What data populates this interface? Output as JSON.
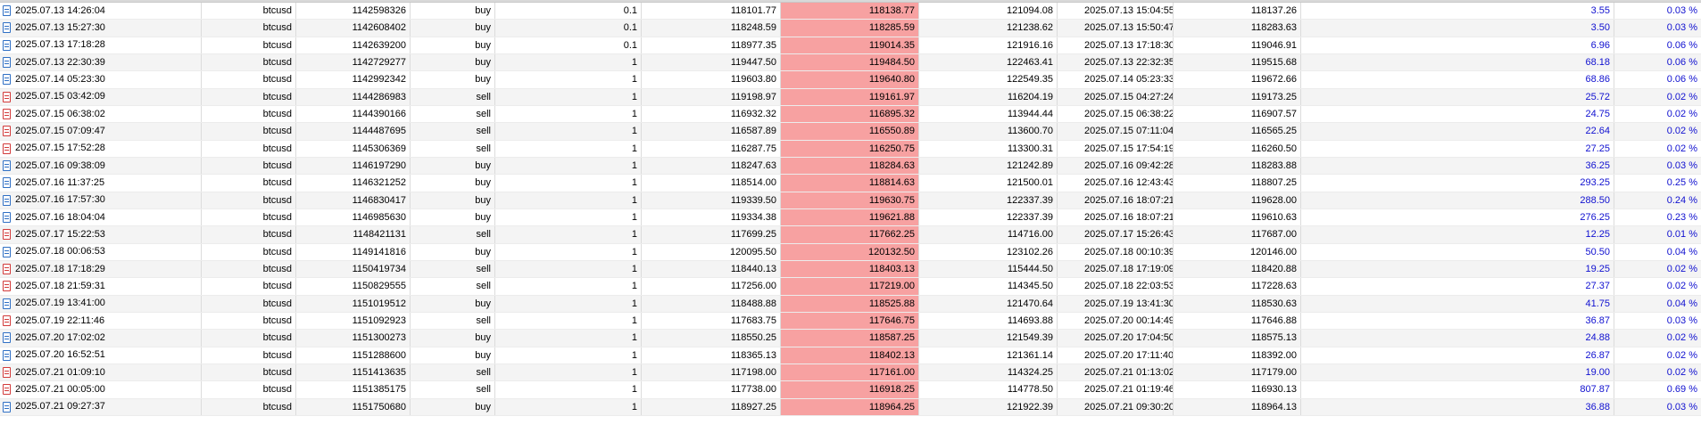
{
  "colors": {
    "highlight": "#f7a1a1",
    "profit_text": "#1010d0",
    "buy_icon": "#2f6fc4",
    "sell_icon": "#d23a3a"
  },
  "icons": {
    "buy": "buy-order-icon",
    "sell": "sell-order-icon"
  },
  "rows": [
    {
      "time": "2025.07.13 14:26:04",
      "symbol": "btcusd",
      "ticket": "1142598326",
      "type": "buy",
      "volume": "0.1",
      "price": "118101.77",
      "sl": "118138.77",
      "tp": "121094.08",
      "close_time": "2025.07.13 15:04:55",
      "close_price": "118137.26",
      "profit": "3.55",
      "pct": "0.03 %"
    },
    {
      "time": "2025.07.13 15:27:30",
      "symbol": "btcusd",
      "ticket": "1142608402",
      "type": "buy",
      "volume": "0.1",
      "price": "118248.59",
      "sl": "118285.59",
      "tp": "121238.62",
      "close_time": "2025.07.13 15:50:47",
      "close_price": "118283.63",
      "profit": "3.50",
      "pct": "0.03 %"
    },
    {
      "time": "2025.07.13 17:18:28",
      "symbol": "btcusd",
      "ticket": "1142639200",
      "type": "buy",
      "volume": "0.1",
      "price": "118977.35",
      "sl": "119014.35",
      "tp": "121916.16",
      "close_time": "2025.07.13 17:18:30",
      "close_price": "119046.91",
      "profit": "6.96",
      "pct": "0.06 %"
    },
    {
      "time": "2025.07.13 22:30:39",
      "symbol": "btcusd",
      "ticket": "1142729277",
      "type": "buy",
      "volume": "1",
      "price": "119447.50",
      "sl": "119484.50",
      "tp": "122463.41",
      "close_time": "2025.07.13 22:32:35",
      "close_price": "119515.68",
      "profit": "68.18",
      "pct": "0.06 %"
    },
    {
      "time": "2025.07.14 05:23:30",
      "symbol": "btcusd",
      "ticket": "1142992342",
      "type": "buy",
      "volume": "1",
      "price": "119603.80",
      "sl": "119640.80",
      "tp": "122549.35",
      "close_time": "2025.07.14 05:23:33",
      "close_price": "119672.66",
      "profit": "68.86",
      "pct": "0.06 %"
    },
    {
      "time": "2025.07.15 03:42:09",
      "symbol": "btcusd",
      "ticket": "1144286983",
      "type": "sell",
      "volume": "1",
      "price": "119198.97",
      "sl": "119161.97",
      "tp": "116204.19",
      "close_time": "2025.07.15 04:27:24",
      "close_price": "119173.25",
      "profit": "25.72",
      "pct": "0.02 %"
    },
    {
      "time": "2025.07.15 06:38:02",
      "symbol": "btcusd",
      "ticket": "1144390166",
      "type": "sell",
      "volume": "1",
      "price": "116932.32",
      "sl": "116895.32",
      "tp": "113944.44",
      "close_time": "2025.07.15 06:38:22",
      "close_price": "116907.57",
      "profit": "24.75",
      "pct": "0.02 %"
    },
    {
      "time": "2025.07.15 07:09:47",
      "symbol": "btcusd",
      "ticket": "1144487695",
      "type": "sell",
      "volume": "1",
      "price": "116587.89",
      "sl": "116550.89",
      "tp": "113600.70",
      "close_time": "2025.07.15 07:11:04",
      "close_price": "116565.25",
      "profit": "22.64",
      "pct": "0.02 %"
    },
    {
      "time": "2025.07.15 17:52:28",
      "symbol": "btcusd",
      "ticket": "1145306369",
      "type": "sell",
      "volume": "1",
      "price": "116287.75",
      "sl": "116250.75",
      "tp": "113300.31",
      "close_time": "2025.07.15 17:54:19",
      "close_price": "116260.50",
      "profit": "27.25",
      "pct": "0.02 %"
    },
    {
      "time": "2025.07.16 09:38:09",
      "symbol": "btcusd",
      "ticket": "1146197290",
      "type": "buy",
      "volume": "1",
      "price": "118247.63",
      "sl": "118284.63",
      "tp": "121242.89",
      "close_time": "2025.07.16 09:42:28",
      "close_price": "118283.88",
      "profit": "36.25",
      "pct": "0.03 %"
    },
    {
      "time": "2025.07.16 11:37:25",
      "symbol": "btcusd",
      "ticket": "1146321252",
      "type": "buy",
      "volume": "1",
      "price": "118514.00",
      "sl": "118814.63",
      "tp": "121500.01",
      "close_time": "2025.07.16 12:43:43",
      "close_price": "118807.25",
      "profit": "293.25",
      "pct": "0.25 %"
    },
    {
      "time": "2025.07.16 17:57:30",
      "symbol": "btcusd",
      "ticket": "1146830417",
      "type": "buy",
      "volume": "1",
      "price": "119339.50",
      "sl": "119630.75",
      "tp": "122337.39",
      "close_time": "2025.07.16 18:07:21",
      "close_price": "119628.00",
      "profit": "288.50",
      "pct": "0.24 %"
    },
    {
      "time": "2025.07.16 18:04:04",
      "symbol": "btcusd",
      "ticket": "1146985630",
      "type": "buy",
      "volume": "1",
      "price": "119334.38",
      "sl": "119621.88",
      "tp": "122337.39",
      "close_time": "2025.07.16 18:07:21",
      "close_price": "119610.63",
      "profit": "276.25",
      "pct": "0.23 %"
    },
    {
      "time": "2025.07.17 15:22:53",
      "symbol": "btcusd",
      "ticket": "1148421131",
      "type": "sell",
      "volume": "1",
      "price": "117699.25",
      "sl": "117662.25",
      "tp": "114716.00",
      "close_time": "2025.07.17 15:26:43",
      "close_price": "117687.00",
      "profit": "12.25",
      "pct": "0.01 %"
    },
    {
      "time": "2025.07.18 00:06:53",
      "symbol": "btcusd",
      "ticket": "1149141816",
      "type": "buy",
      "volume": "1",
      "price": "120095.50",
      "sl": "120132.50",
      "tp": "123102.26",
      "close_time": "2025.07.18 00:10:39",
      "close_price": "120146.00",
      "profit": "50.50",
      "pct": "0.04 %"
    },
    {
      "time": "2025.07.18 17:18:29",
      "symbol": "btcusd",
      "ticket": "1150419734",
      "type": "sell",
      "volume": "1",
      "price": "118440.13",
      "sl": "118403.13",
      "tp": "115444.50",
      "close_time": "2025.07.18 17:19:09",
      "close_price": "118420.88",
      "profit": "19.25",
      "pct": "0.02 %"
    },
    {
      "time": "2025.07.18 21:59:31",
      "symbol": "btcusd",
      "ticket": "1150829555",
      "type": "sell",
      "volume": "1",
      "price": "117256.00",
      "sl": "117219.00",
      "tp": "114345.50",
      "close_time": "2025.07.18 22:03:53",
      "close_price": "117228.63",
      "profit": "27.37",
      "pct": "0.02 %"
    },
    {
      "time": "2025.07.19 13:41:00",
      "symbol": "btcusd",
      "ticket": "1151019512",
      "type": "buy",
      "volume": "1",
      "price": "118488.88",
      "sl": "118525.88",
      "tp": "121470.64",
      "close_time": "2025.07.19 13:41:30",
      "close_price": "118530.63",
      "profit": "41.75",
      "pct": "0.04 %"
    },
    {
      "time": "2025.07.19 22:11:46",
      "symbol": "btcusd",
      "ticket": "1151092923",
      "type": "sell",
      "volume": "1",
      "price": "117683.75",
      "sl": "117646.75",
      "tp": "114693.88",
      "close_time": "2025.07.20 00:14:49",
      "close_price": "117646.88",
      "profit": "36.87",
      "pct": "0.03 %"
    },
    {
      "time": "2025.07.20 17:02:02",
      "symbol": "btcusd",
      "ticket": "1151300273",
      "type": "buy",
      "volume": "1",
      "price": "118550.25",
      "sl": "118587.25",
      "tp": "121549.39",
      "close_time": "2025.07.20 17:04:50",
      "close_price": "118575.13",
      "profit": "24.88",
      "pct": "0.02 %"
    },
    {
      "time": "2025.07.20 16:52:51",
      "symbol": "btcusd",
      "ticket": "1151288600",
      "type": "buy",
      "volume": "1",
      "price": "118365.13",
      "sl": "118402.13",
      "tp": "121361.14",
      "close_time": "2025.07.20 17:11:40",
      "close_price": "118392.00",
      "profit": "26.87",
      "pct": "0.02 %"
    },
    {
      "time": "2025.07.21 01:09:10",
      "symbol": "btcusd",
      "ticket": "1151413635",
      "type": "sell",
      "volume": "1",
      "price": "117198.00",
      "sl": "117161.00",
      "tp": "114324.25",
      "close_time": "2025.07.21 01:13:02",
      "close_price": "117179.00",
      "profit": "19.00",
      "pct": "0.02 %"
    },
    {
      "time": "2025.07.21 00:05:00",
      "symbol": "btcusd",
      "ticket": "1151385175",
      "type": "sell",
      "volume": "1",
      "price": "117738.00",
      "sl": "116918.25",
      "tp": "114778.50",
      "close_time": "2025.07.21 01:19:46",
      "close_price": "116930.13",
      "profit": "807.87",
      "pct": "0.69 %"
    },
    {
      "time": "2025.07.21 09:27:37",
      "symbol": "btcusd",
      "ticket": "1151750680",
      "type": "buy",
      "volume": "1",
      "price": "118927.25",
      "sl": "118964.25",
      "tp": "121922.39",
      "close_time": "2025.07.21 09:30:20",
      "close_price": "118964.13",
      "profit": "36.88",
      "pct": "0.03 %"
    }
  ]
}
